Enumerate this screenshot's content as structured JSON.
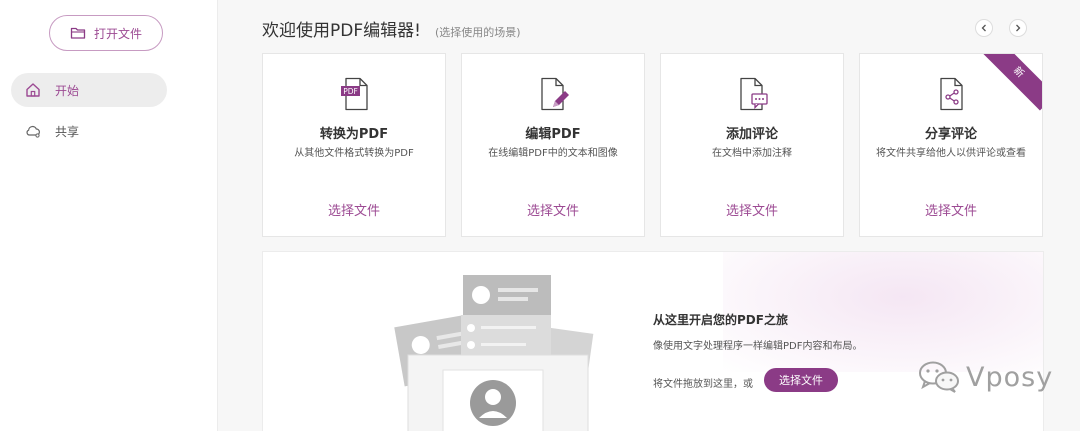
{
  "sidebar": {
    "open_file_label": "打开文件",
    "items": [
      {
        "label": "开始",
        "active": true
      },
      {
        "label": "共享",
        "active": false
      }
    ]
  },
  "header": {
    "title": "欢迎使用PDF编辑器!",
    "subtitle": "(选择使用的场景)"
  },
  "cards": [
    {
      "title": "转换为PDF",
      "description": "从其他文件格式转换为PDF",
      "action": "选择文件",
      "icon": "pdf-file-icon"
    },
    {
      "title": "编辑PDF",
      "description": "在线编辑PDF中的文本和图像",
      "action": "选择文件",
      "icon": "edit-file-icon"
    },
    {
      "title": "添加评论",
      "description": "在文档中添加注释",
      "action": "选择文件",
      "icon": "comment-file-icon"
    },
    {
      "title": "分享评论",
      "description": "将文件共享给他人以供评论或查看",
      "action": "选择文件",
      "icon": "share-file-icon",
      "badge": "新"
    }
  ],
  "banner": {
    "title": "从这里开启您的PDF之旅",
    "description": "像使用文字处理程序一样编辑PDF内容和布局。",
    "drop_text": "将文件拖放到这里，或",
    "button_label": "选择文件"
  },
  "watermark": {
    "text": "Vposy"
  },
  "colors": {
    "accent": "#8b3b86",
    "accent_text": "#9c4a93",
    "background": "#f7f7f7"
  }
}
